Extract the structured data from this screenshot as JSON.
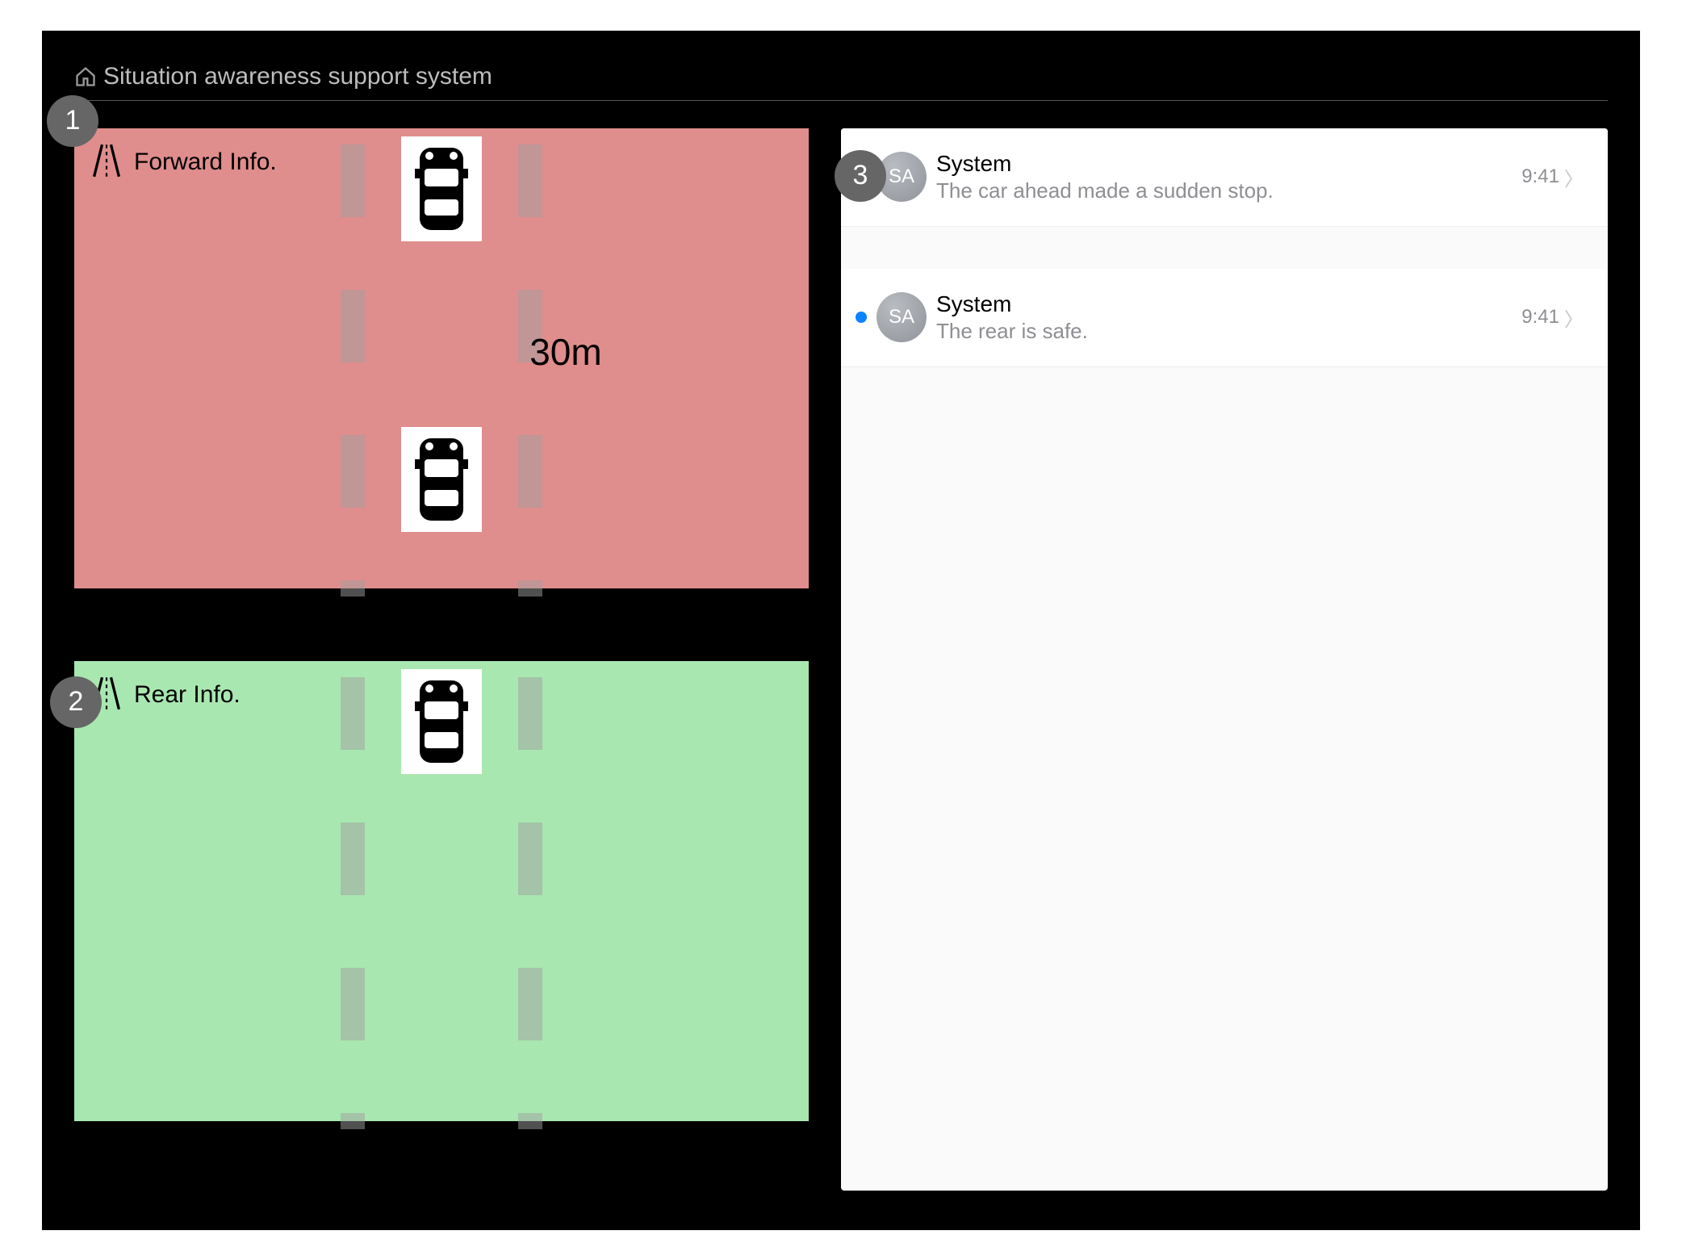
{
  "header": {
    "title": "Situation awareness support system",
    "home_icon": "home-icon"
  },
  "callouts": {
    "c1": "1",
    "c2": "2",
    "c3": "3"
  },
  "panels": {
    "forward": {
      "label": "Forward Info.",
      "distance": "30m",
      "bg_color": "#e08d8d",
      "road_icon": "road-icon",
      "car_count": 2
    },
    "rear": {
      "label": "Rear Info.",
      "bg_color": "#a9e7b0",
      "road_icon": "road-icon",
      "car_count": 1
    }
  },
  "messages": [
    {
      "avatar_initials": "SA",
      "sender": "System",
      "text": "The car ahead made a sudden stop.",
      "time": "9:41",
      "unread": true
    },
    {
      "avatar_initials": "SA",
      "sender": "System",
      "text": "The rear is safe.",
      "time": "9:41",
      "unread": true
    }
  ]
}
